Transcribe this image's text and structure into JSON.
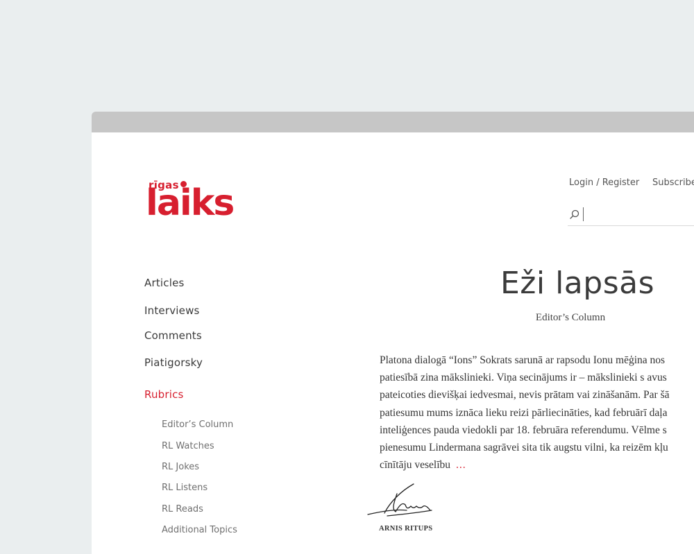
{
  "logo": {
    "small": "rīgas",
    "big": "laiks"
  },
  "header": {
    "login": "Login / Register",
    "subscribe": "Subscribe"
  },
  "search": {
    "value": "",
    "placeholder": ""
  },
  "nav": {
    "items": [
      "Articles",
      "Interviews",
      "Comments",
      "Piatigorsky"
    ],
    "rubrics": "Rubrics",
    "sub_items": [
      "Editor’s Column",
      "RL Watches",
      "RL Jokes",
      "RL Listens",
      "RL Reads",
      "Additional Topics"
    ]
  },
  "article": {
    "title": "Eži lapsās",
    "category": "Editor’s Column",
    "lines": [
      "Platona dialogā “Ions” Sokrats sarunā ar rapsodu Ionu mēģina nos",
      "patiesībā zina mākslinieki. Viņa secinājums ir – mākslinieki s avus",
      "pateicoties dievišķai iedvesmai, nevis prātam vai zināšanām. Par šā",
      "patiesumu mums iznāca lieku reizi pārliecināties, kad februārī daļa",
      "inteliģences pauda viedokli par 18. februāra referendumu. Vēlme s",
      "pienesumu Lindermana sagrāvei sita tik augstu vilni, ka reizēm kļu",
      "cīnītāju veselību"
    ],
    "more": "...",
    "author": "ARNIS RITUPS"
  },
  "colors": {
    "brand": "#d71f2f",
    "background": "#eaeeef",
    "titlebar": "#c6c6c6"
  }
}
